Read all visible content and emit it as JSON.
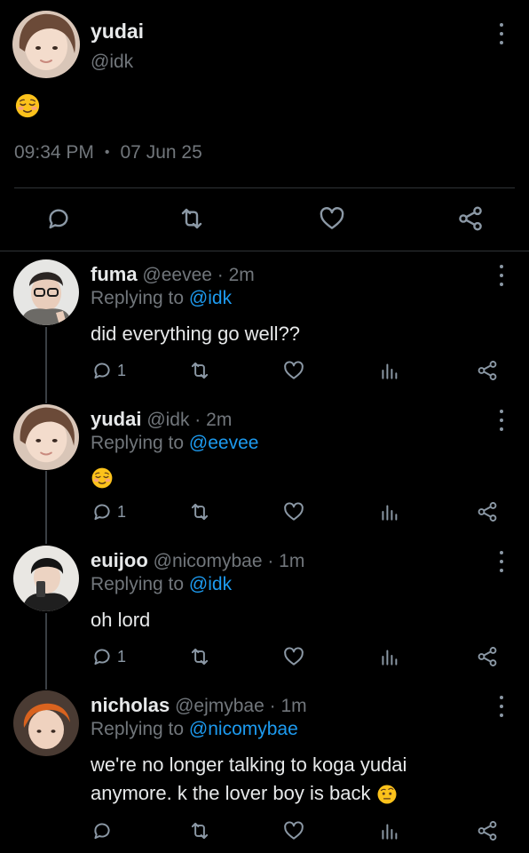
{
  "main_tweet": {
    "author_name": "yudai",
    "author_handle": "@idk",
    "emoji": "relieved-face",
    "time": "09:34 PM",
    "separator": "•",
    "date": "07 Jun 25"
  },
  "replies": [
    {
      "name": "fuma",
      "handle_time": "@eevee · 2m",
      "replying_prefix": "Replying to",
      "replying_to": "@idk",
      "text": "did everything go well??",
      "reply_count": "1"
    },
    {
      "name": "yudai",
      "handle_time": "@idk · 2m",
      "replying_prefix": "Replying to",
      "replying_to": "@eevee",
      "text": "",
      "emoji": "relieved-face",
      "reply_count": "1"
    },
    {
      "name": "euijoo",
      "handle_time": "@nicomybae · 1m",
      "replying_prefix": "Replying to",
      "replying_to": "@idk",
      "text": "oh lord",
      "reply_count": "1"
    },
    {
      "name": "nicholas",
      "handle_time": "@ejmybae · 1m",
      "replying_prefix": "Replying to",
      "replying_to": "@nicomybae",
      "text_line1": "we're no longer talking to koga yudai",
      "text_line2": "anymore. k the lover boy is back",
      "emoji": "face-with-raised-eyebrow",
      "reply_count": ""
    }
  ],
  "colors": {
    "background": "#000000",
    "text": "#e7e9ea",
    "secondary": "#71767b",
    "link": "#1d9bf0",
    "icon": "#8b98a5",
    "divider": "#2f3336"
  }
}
